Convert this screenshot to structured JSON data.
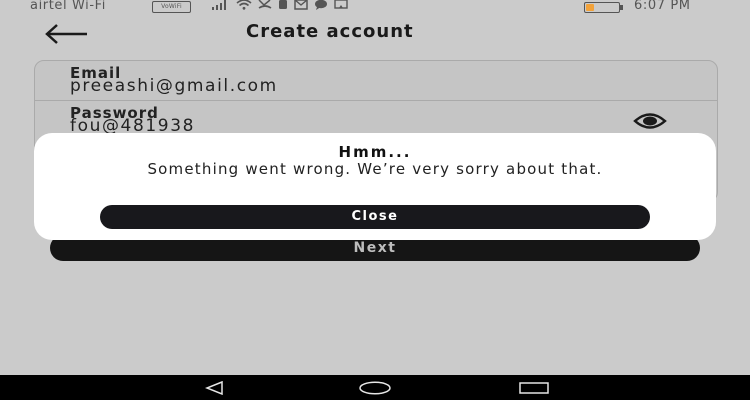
{
  "status_bar": {
    "carrier": "airtel Wi-Fi",
    "vowifi_badge": "VoWiFi",
    "icons": [
      "signal-icon",
      "wifi-icon",
      "missed-call-icon",
      "notification-icon",
      "mail-icon",
      "chat-icon",
      "cast-icon"
    ],
    "battery_percent": 25,
    "battery_color": "#f2a23a",
    "time": "6:07 PM"
  },
  "header": {
    "back_icon": "arrow-left-icon",
    "title": "Create account"
  },
  "form": {
    "email_label": "Email",
    "email_value": "preeashi@gmail.com",
    "password_label": "Password",
    "password_value": "fou@481938",
    "visibility_icon": "eye-icon"
  },
  "next_button": {
    "label": "Next"
  },
  "dialog": {
    "title": "Hmm...",
    "message": "Something went wrong. We’re very sorry about that.",
    "close_label": "Close"
  },
  "nav_bar": {
    "icons": [
      "nav-back-icon",
      "nav-home-icon",
      "nav-recents-icon"
    ]
  }
}
